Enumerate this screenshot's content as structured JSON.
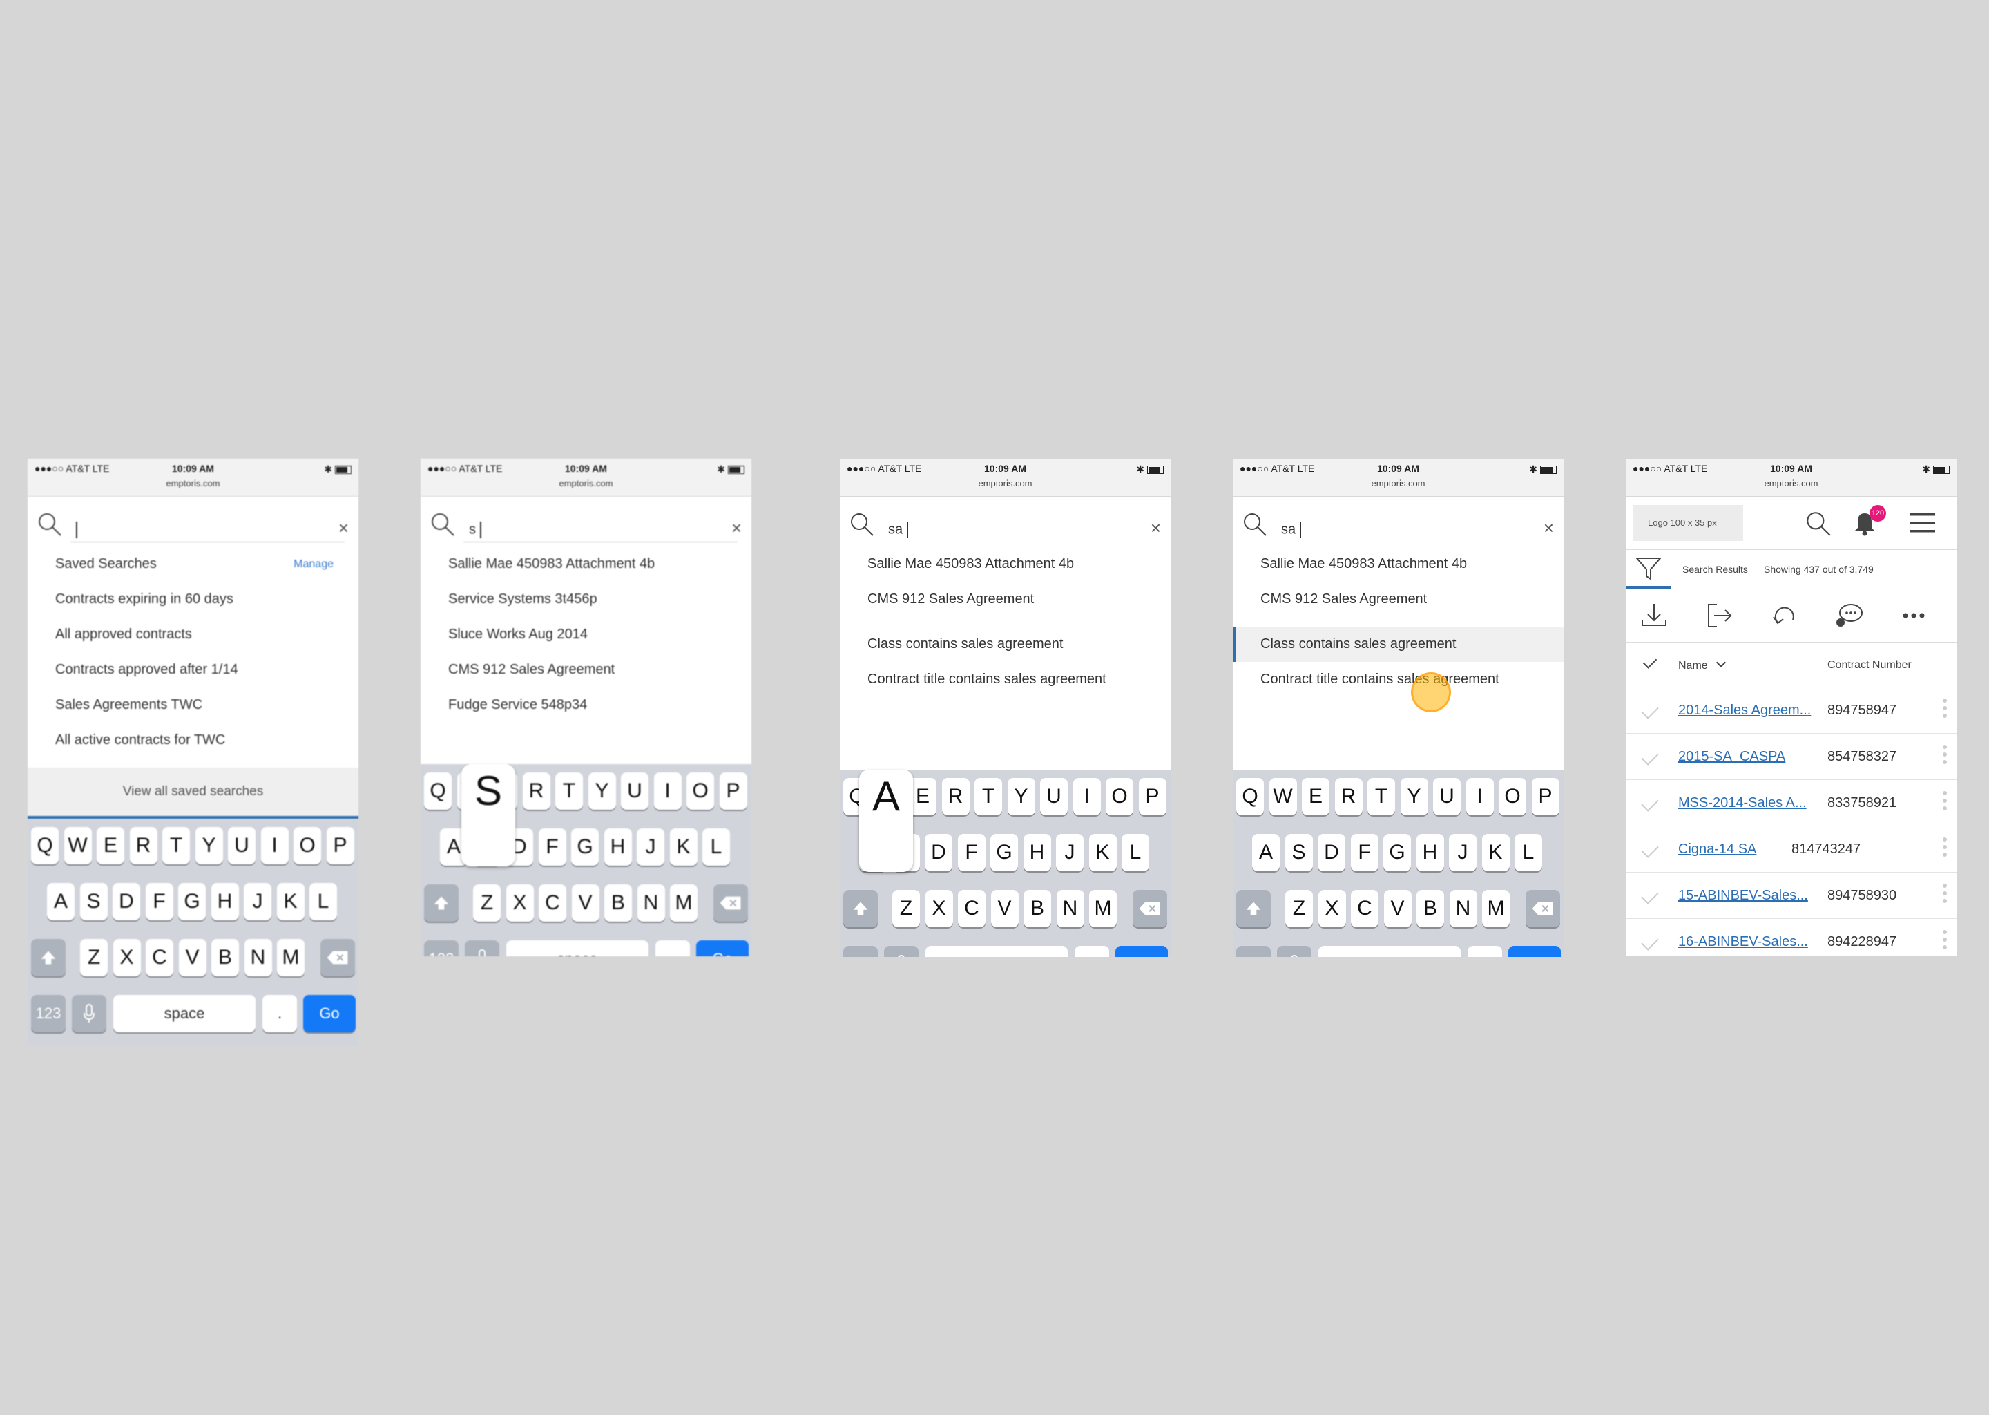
{
  "status": {
    "carrier": "●●●○○ AT&T  LTE",
    "time": "10:09 AM",
    "url": "emptoris.com"
  },
  "screen1": {
    "search_value": "",
    "saved_title": "Saved Searches",
    "manage_label": "Manage",
    "items": [
      "Contracts expiring in 60 days",
      "All approved contracts",
      "Contracts approved after 1/14",
      "Sales Agreements TWC",
      "All active contracts for TWC"
    ],
    "view_all_label": "View all saved searches"
  },
  "screen2": {
    "search_value": "s",
    "items": [
      "Sallie Mae 450983 Attachment 4b",
      "Service Systems 3t456p",
      "Sluce Works Aug 2014",
      "CMS 912 Sales Agreement",
      "Fudge Service 548p34"
    ],
    "popup_key": "S"
  },
  "screen3": {
    "search_value": "sa",
    "items": [
      "Sallie Mae 450983 Attachment 4b",
      "CMS 912 Sales Agreement"
    ],
    "rules": [
      "Class contains sales agreement",
      "Contract title contains sales agreement"
    ],
    "popup_key": "A"
  },
  "screen4": {
    "search_value": "sa",
    "items": [
      "Sallie Mae 450983 Attachment 4b",
      "CMS 912 Sales Agreement"
    ],
    "rules": [
      "Class contains sales agreement",
      "Contract title contains sales agreement"
    ],
    "selected_index": 0
  },
  "keyboard": {
    "row1": [
      "Q",
      "W",
      "E",
      "R",
      "T",
      "Y",
      "U",
      "I",
      "O",
      "P"
    ],
    "row2": [
      "A",
      "S",
      "D",
      "F",
      "G",
      "H",
      "J",
      "K",
      "L"
    ],
    "row3": [
      "Z",
      "X",
      "C",
      "V",
      "B",
      "N",
      "M"
    ],
    "numbers_label": "123",
    "space_label": "space",
    "period_label": ".",
    "go_label": "Go"
  },
  "results": {
    "logo_placeholder": "Logo 100 x 35 px",
    "notification_count": "120",
    "results_label": "Search Results",
    "showing_label": "Showing 437 out of 3,749",
    "col_name": "Name",
    "col_number": "Contract Number",
    "rows": [
      {
        "name": "2014-Sales Agreem...",
        "number": "894758947"
      },
      {
        "name": "2015-SA_CASPA",
        "number": "854758327"
      },
      {
        "name": "MSS-2014-Sales A...",
        "number": "833758921"
      },
      {
        "name": "Cigna-14 SA",
        "number": "814743247"
      },
      {
        "name": "15-ABINBEV-Sales...",
        "number": "894758930"
      },
      {
        "name": "16-ABINBEV-Sales...",
        "number": "894228947"
      }
    ]
  },
  "colors": {
    "accent": "#2f6fb0",
    "go_key": "#1479f6",
    "badge": "#e5197a",
    "touch": "#ffb000",
    "background": "#d6d6d6"
  }
}
